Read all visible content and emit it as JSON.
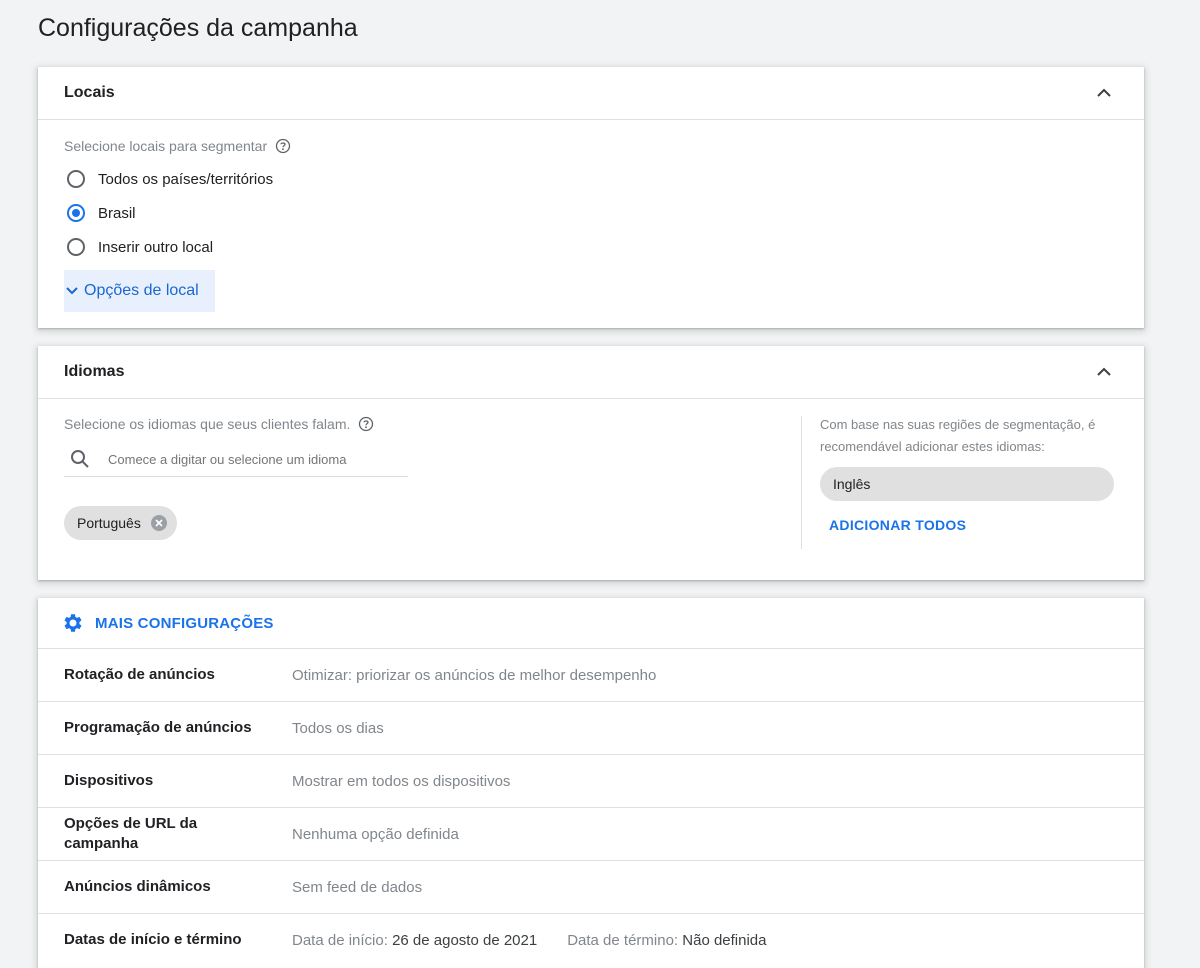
{
  "page": {
    "title": "Configurações da campanha"
  },
  "locais": {
    "title": "Locais",
    "prompt": "Selecione locais para segmentar",
    "options": [
      {
        "label": "Todos os países/territórios",
        "checked": false
      },
      {
        "label": "Brasil",
        "checked": true
      },
      {
        "label": "Inserir outro local",
        "checked": false
      }
    ],
    "options_link": "Opções de local"
  },
  "idiomas": {
    "title": "Idiomas",
    "prompt": "Selecione os idiomas que seus clientes falam.",
    "search_placeholder": "Comece a digitar ou selecione um idioma",
    "selected_chip": "Português",
    "recommend_text": "Com base nas suas regiões de segmentação, é recomendável adicionar estes idiomas:",
    "recommended": "Inglês",
    "add_all": "ADICIONAR TODOS"
  },
  "mais": {
    "title": "MAIS CONFIGURAÇÕES",
    "rows": [
      {
        "label": "Rotação de anúncios",
        "value": "Otimizar: priorizar os anúncios de melhor desempenho"
      },
      {
        "label": "Programação de anúncios",
        "value": "Todos os dias"
      },
      {
        "label": "Dispositivos",
        "value": "Mostrar em todos os dispositivos"
      },
      {
        "label": "Opções de URL da campanha",
        "value": "Nenhuma opção definida"
      },
      {
        "label": "Anúncios dinâmicos",
        "value": "Sem feed de dados"
      }
    ],
    "dates": {
      "label": "Datas de início e término",
      "start_label": "Data de início:",
      "start_value": "26 de agosto de 2021",
      "end_label": "Data de término:",
      "end_value": "Não definida"
    }
  },
  "colors": {
    "accent": "#1a73e8",
    "highlight": "#e8f0fe"
  }
}
